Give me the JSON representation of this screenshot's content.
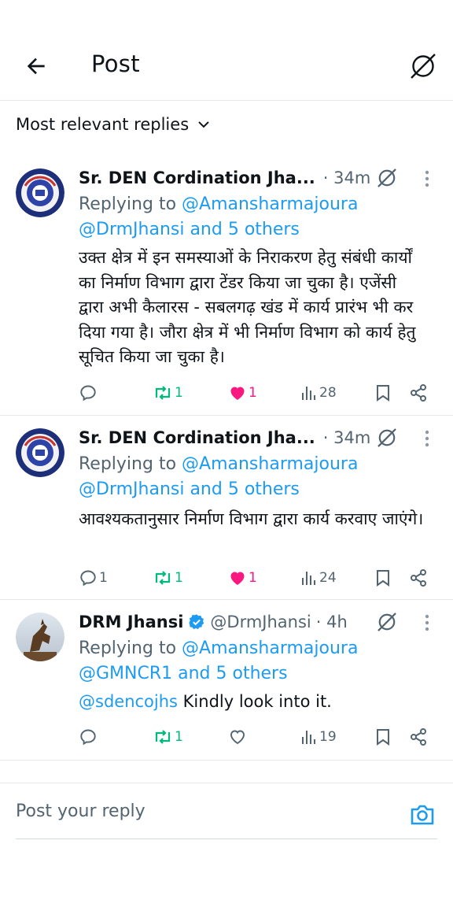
{
  "header": {
    "title": "Post"
  },
  "sort": {
    "label": "Most relevant replies"
  },
  "tweets": [
    {
      "name": "Sr. DEN Cordination Jha...",
      "handle": "",
      "time": "· 34m",
      "reply_prefix": "Replying to ",
      "reply_line1_link": "@Amansharmajoura",
      "reply_line2_link": "@DrmJhansi and 5 others",
      "text": "उक्त क्षेत्र में इन समस्याओं के निराकरण हेतु संबंधी कार्यों का निर्माण विभाग द्वारा टेंडर किया जा चुका है। एजेंसी द्वारा अभी कैलारस - सबलगढ़ खंड में कार्य प्रारंभ भी कर दिया गया है। जौरा क्षेत्र में भी निर्माण विभाग को कार्य हेतु सूचित किया जा चुका है।",
      "replies": "",
      "reposts": "1",
      "likes": "1",
      "views": "28"
    },
    {
      "name": "Sr. DEN Cordination Jha...",
      "handle": "",
      "time": "· 34m",
      "reply_prefix": "Replying to ",
      "reply_line1_link": "@Amansharmajoura",
      "reply_line2_link": "@DrmJhansi and 5 others",
      "text": "आवश्यकतानुसार निर्माण विभाग द्वारा कार्य करवाए जाएंगे।",
      "replies": "1",
      "reposts": "1",
      "likes": "1",
      "views": "24"
    },
    {
      "name": "DRM Jhansi",
      "handle": "@DrmJhansi",
      "time": "· 4h",
      "reply_prefix": "Replying to ",
      "reply_line1_link": "@Amansharmajoura",
      "reply_line2_link": "@GMNCR1 and 5 others",
      "text_mention": "@sdencojhs",
      "text": " Kindly look into it.",
      "replies": "",
      "reposts": "1",
      "likes": "",
      "views": "19"
    }
  ],
  "reply_box": {
    "placeholder": "Post your reply"
  },
  "colors": {
    "link": "#1d9bf0",
    "repost": "#00ba7c",
    "like": "#f91880",
    "muted": "#536471",
    "verified": "#1d9bf0"
  },
  "icons": [
    "back-arrow-icon",
    "grok-icon",
    "chevron-down-icon",
    "more-icon",
    "reply-icon",
    "repost-icon",
    "heart-icon",
    "views-icon",
    "bookmark-icon",
    "share-icon",
    "verified-icon",
    "camera-icon"
  ]
}
